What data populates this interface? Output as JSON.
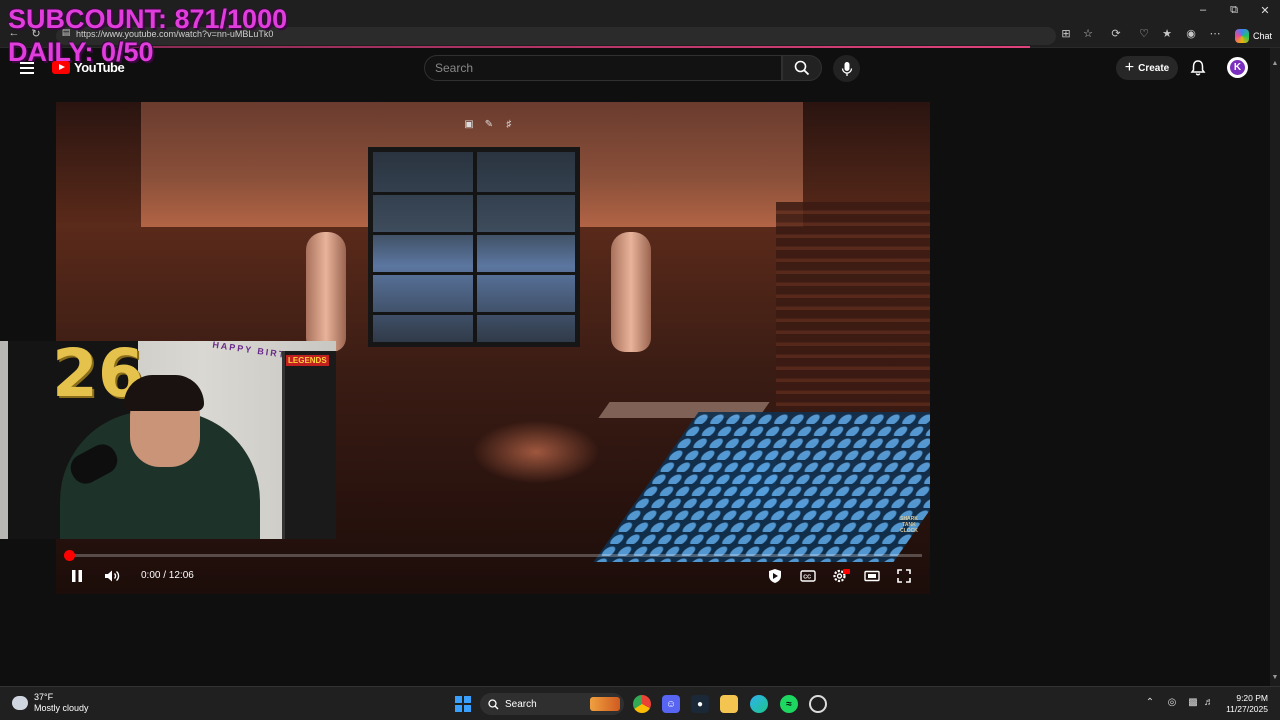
{
  "browser": {
    "url": "https://www.youtube.com/watch?v=nn-uMBLuTk0",
    "chat_label": "Chat"
  },
  "overlay": {
    "subcount": "SUBCOUNT: 871/1000",
    "daily": "DAILY: 0/50"
  },
  "youtube": {
    "logo_text": "YouTube",
    "search_placeholder": "Search",
    "create_label": "Create",
    "avatar_letter": "K"
  },
  "player": {
    "time_display": "0:00 / 12:06",
    "progress_fraction": 0.0
  },
  "webcam": {
    "balloon_number": "26",
    "banner_text": "HAPPY BIRTHDAY",
    "arcade_label": "LEGENDS"
  },
  "video_watermark": "SHARK TANK CLOCK",
  "taskbar": {
    "weather_temp": "37°F",
    "weather_desc": "Mostly cloudy",
    "search_label": "Search",
    "time": "9:20 PM",
    "date": "11/27/2025"
  },
  "colors": {
    "overlay_text": "#e13ddc",
    "yt_red": "#ff0000",
    "page_bg": "#0f0f0f"
  }
}
